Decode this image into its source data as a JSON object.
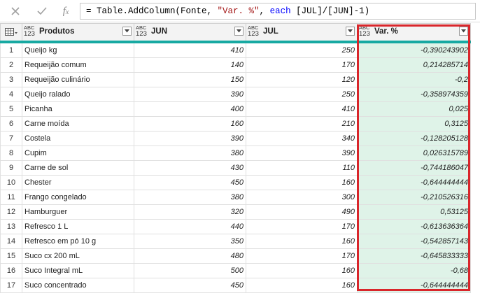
{
  "formula_bar": {
    "prefix": "= Table.AddColumn(Fonte, ",
    "string_arg": "\"Var. %\"",
    "mid": ", ",
    "keyword": "each",
    "expression": " [JUL]/[JUN]-1)",
    "icons": [
      "close-icon",
      "check-icon",
      "fx-icon"
    ]
  },
  "columns": [
    {
      "type_top": "ABC",
      "type_bottom": "123",
      "label": "Produtos"
    },
    {
      "type_top": "ABC",
      "type_bottom": "123",
      "label": "JUN"
    },
    {
      "type_top": "ABC",
      "type_bottom": "123",
      "label": "JUL"
    },
    {
      "type_top": "ABC",
      "type_bottom": "123",
      "label": "Var. %"
    }
  ],
  "rows": [
    {
      "n": "1",
      "produto": "Queijo kg",
      "jun": "410",
      "jul": "250",
      "var": "-0,390243902"
    },
    {
      "n": "2",
      "produto": "Requeijão comum",
      "jun": "140",
      "jul": "170",
      "var": "0,214285714"
    },
    {
      "n": "3",
      "produto": "Requeijão culinário",
      "jun": "150",
      "jul": "120",
      "var": "-0,2"
    },
    {
      "n": "4",
      "produto": "Queijo ralado",
      "jun": "390",
      "jul": "250",
      "var": "-0,358974359"
    },
    {
      "n": "5",
      "produto": "Picanha",
      "jun": "400",
      "jul": "410",
      "var": "0,025"
    },
    {
      "n": "6",
      "produto": "Carne moída",
      "jun": "160",
      "jul": "210",
      "var": "0,3125"
    },
    {
      "n": "7",
      "produto": "Costela",
      "jun": "390",
      "jul": "340",
      "var": "-0,128205128"
    },
    {
      "n": "8",
      "produto": "Cupim",
      "jun": "380",
      "jul": "390",
      "var": "0,026315789"
    },
    {
      "n": "9",
      "produto": "Carne de sol",
      "jun": "430",
      "jul": "110",
      "var": "-0,744186047"
    },
    {
      "n": "10",
      "produto": "Chester",
      "jun": "450",
      "jul": "160",
      "var": "-0,644444444"
    },
    {
      "n": "11",
      "produto": "Frango congelado",
      "jun": "380",
      "jul": "300",
      "var": "-0,210526316"
    },
    {
      "n": "12",
      "produto": "Hamburguer",
      "jun": "320",
      "jul": "490",
      "var": "0,53125"
    },
    {
      "n": "13",
      "produto": "Refresco 1 L",
      "jun": "440",
      "jul": "170",
      "var": "-0,613636364"
    },
    {
      "n": "14",
      "produto": "Refresco em pó 10 g",
      "jun": "350",
      "jul": "160",
      "var": "-0,542857143"
    },
    {
      "n": "15",
      "produto": "Suco cx 200 mL",
      "jun": "480",
      "jul": "170",
      "var": "-0,645833333"
    },
    {
      "n": "16",
      "produto": "Suco Integral mL",
      "jun": "500",
      "jul": "160",
      "var": "-0,68"
    },
    {
      "n": "17",
      "produto": "Suco concentrado",
      "jun": "450",
      "jul": "160",
      "var": "-0,644444444"
    }
  ],
  "colors": {
    "accent": "#17a9a2",
    "highlight": "#d9262b",
    "var_fill": "#dff3e8"
  }
}
